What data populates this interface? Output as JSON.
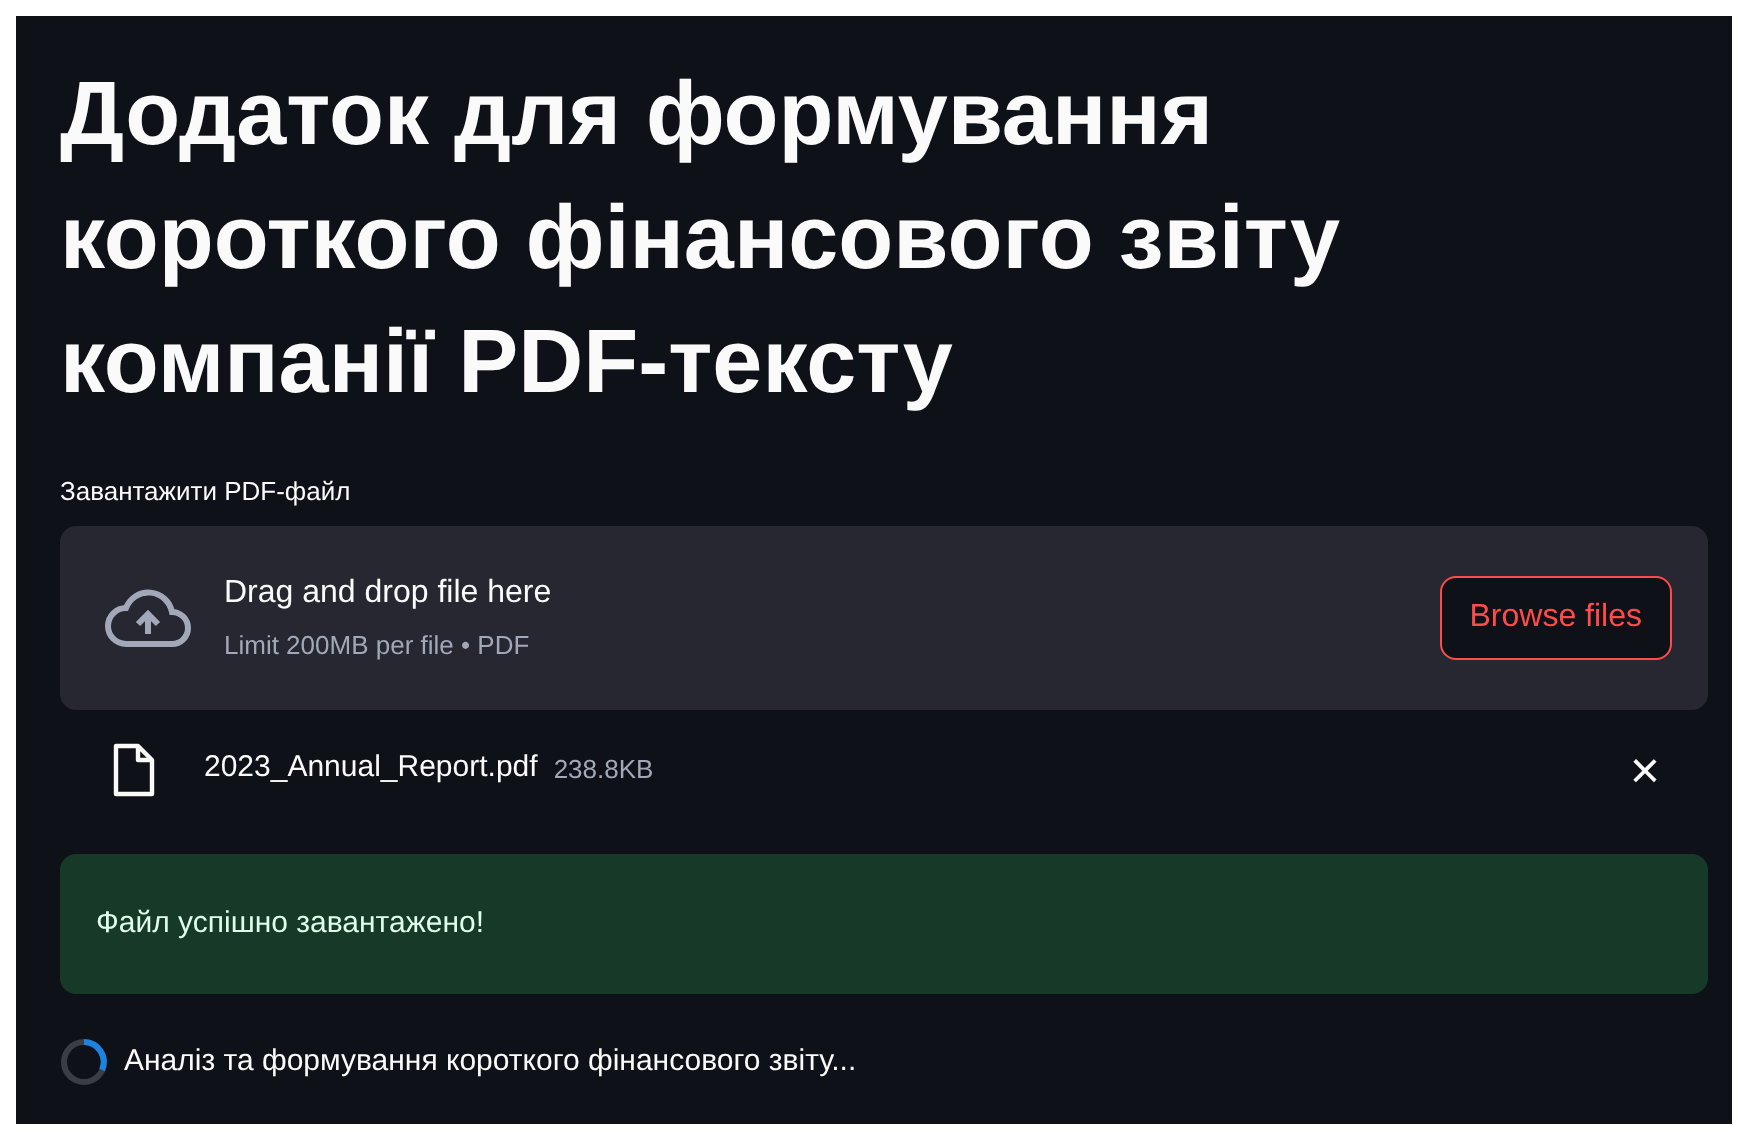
{
  "title": "Додаток для формування короткого фінансового звіту компанії PDF-тексту",
  "uploader": {
    "label": "Завантажити PDF-файл",
    "instruction": "Drag and drop file here",
    "limit": "Limit 200MB per file • PDF",
    "button": "Browse files"
  },
  "files": [
    {
      "name": "2023_Annual_Report.pdf",
      "size": "238.8KB",
      "remove": "×"
    }
  ],
  "alert": {
    "kind": "success",
    "text": "Файл успішно завантажено!"
  },
  "spinner": {
    "text": "Аналіз та формування короткого фінансового звіту..."
  }
}
